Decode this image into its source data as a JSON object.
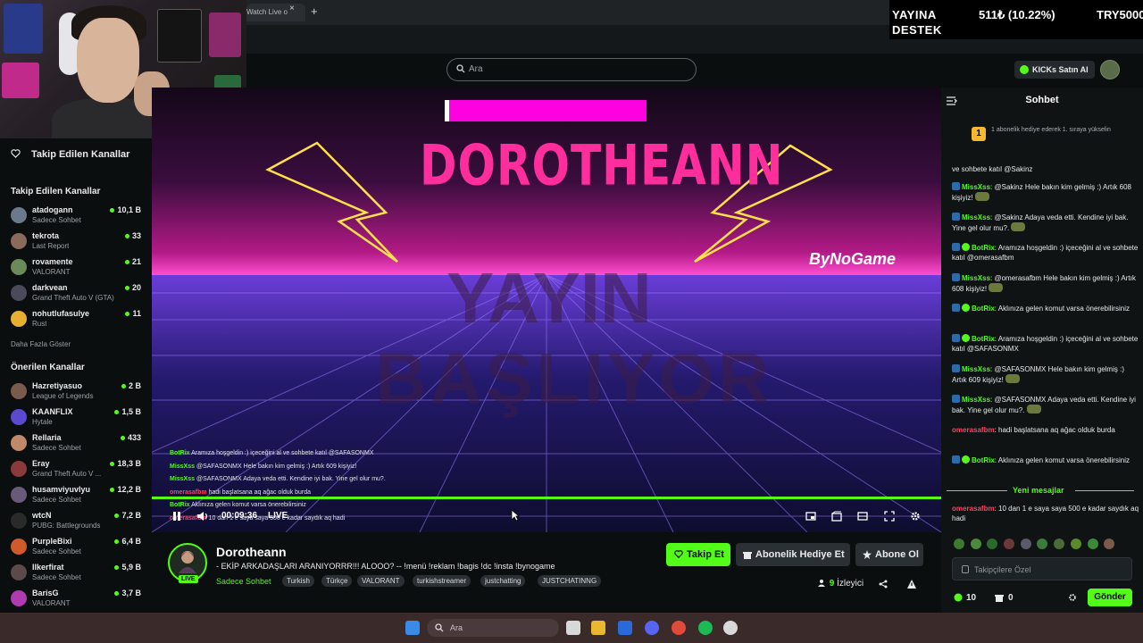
{
  "browser": {
    "tab_label": "Watch Live o",
    "tab_close": "×",
    "new_tab": "+"
  },
  "overlay": {
    "line1": "YAYINA",
    "line2": "DESTEK",
    "amount": "511₺ (10.22%)",
    "goal": "TRY5000"
  },
  "header": {
    "search_placeholder": "Ara",
    "kicks_button": "KICKs Satın Al"
  },
  "sidebar": {
    "title": "Takip Edilen Kanallar",
    "followed_header": "Takip Edilen Kanallar",
    "followed": [
      {
        "name": "atadogann",
        "category": "Sadece Sohbet",
        "viewers": "10,1 B",
        "color": "#6a7a8a"
      },
      {
        "name": "tekrota",
        "category": "Last Report",
        "viewers": "33",
        "color": "#8a6a5a"
      },
      {
        "name": "rovamente",
        "category": "VALORANT",
        "viewers": "21",
        "color": "#6a8a5a"
      },
      {
        "name": "darkvean",
        "category": "Grand Theft Auto V (GTA)",
        "viewers": "20",
        "color": "#4a4a5a"
      },
      {
        "name": "nohutlufasulye",
        "category": "Rust",
        "viewers": "11",
        "color": "#e8b030"
      }
    ],
    "show_more": "Daha Fazla Göster",
    "recommended_header": "Önerilen Kanallar",
    "recommended": [
      {
        "name": "Hazretiyasuo",
        "category": "League of Legends",
        "viewers": "2 B",
        "color": "#7a5a4a"
      },
      {
        "name": "KAANFLIX",
        "category": "Hytale",
        "viewers": "1,5 B",
        "color": "#5a4ad0"
      },
      {
        "name": "Rellaria",
        "category": "Sadece Sohbet",
        "viewers": "433",
        "color": "#c08a6a"
      },
      {
        "name": "Eray",
        "category": "Grand Theft Auto V ...",
        "viewers": "18,3 B",
        "color": "#8a3a3a"
      },
      {
        "name": "husamviyuvlyu",
        "category": "Sadece Sohbet",
        "viewers": "12,2 B",
        "color": "#6a5a7a"
      },
      {
        "name": "wtcN",
        "category": "PUBG: Battlegrounds",
        "viewers": "7,2 B",
        "color": "#2a2a2a"
      },
      {
        "name": "PurpleBixi",
        "category": "Sadece Sohbet",
        "viewers": "6,4 B",
        "color": "#d05a2a"
      },
      {
        "name": "Ilkerfirat",
        "category": "Sadece Sohbet",
        "viewers": "5,9 B",
        "color": "#5a4a4a"
      },
      {
        "name": "BarisG",
        "category": "VALORANT",
        "viewers": "3,7 B",
        "color": "#b03ab0"
      }
    ]
  },
  "video": {
    "title_art": "DOROTHEANN",
    "brand_art": "ByNoGame",
    "starting_line1": "YAYIN",
    "starting_line2": "BAŞLIYOR",
    "overlay_chat": [
      {
        "user": "BotRix",
        "text": "Aramıza hoşgeldin :) içeceğini al ve sohbete katıl @SAFASONMX"
      },
      {
        "user": "MissXss",
        "text": "@SAFASONMX Hele bakın kim gelmiş :) Artık 609 kişiyiz!"
      },
      {
        "user": "MissXss",
        "text": "@SAFASONMX Adaya veda etti. Kendine iyi bak. Yine gel olur mu?."
      },
      {
        "user": "omerasafbm",
        "text": "hadi başlatsana aq ağac olduk burda"
      },
      {
        "user": "BotRix",
        "text": "Aklınıza gelen komut varsa önerebilirsiniz"
      },
      {
        "user": "omerasafbm",
        "text": "10 dan 1 e saya saya 500 e kadar saydık aq hadi"
      }
    ],
    "elapsed": "00:09:36",
    "live_label": "LIVE",
    "progress": 1.0
  },
  "stream": {
    "name": "Dorotheann",
    "live_badge": "LIVE",
    "title": "- EKİP ARKADAŞLARI ARANIYORRR!!! ALOOO? -- !menü !reklam !bagis !dc !insta !bynogame",
    "category": "Sadece Sohbet",
    "tags": [
      "Turkish",
      "Türkçe",
      "VALORANT",
      "turkishstreamer",
      "justchatting",
      "JUSTCHATINNG"
    ],
    "follow_button": "Takip Et",
    "gift_button": "Abonelik Hediye Et",
    "subscribe_button": "Abone Ol",
    "viewer_count": "9",
    "viewer_label": "İzleyici"
  },
  "chat": {
    "title": "Sohbet",
    "pinned_rank": "1",
    "pinned_text": "1 abonelik hediye ederek 1. sıraya yükselin",
    "messages": [
      {
        "user": "",
        "text": "ve sohbete katıl @Sakinz"
      },
      {
        "user": "MissXss",
        "text": "@Sakinz Hele bakın kim gelmiş :) Artık 608 kişiyiz!"
      },
      {
        "user": "MissXss",
        "text": "@Sakinz Adaya veda etti. Kendine iyi bak. Yine gel olur mu?."
      },
      {
        "user": "BotRix",
        "text": "Aramıza hoşgeldin :) içeceğini al ve sohbete katıl @omerasafbm"
      },
      {
        "user": "MissXss",
        "text": "@omerasafbm Hele bakın kim gelmiş :) Artık 608 kişiyiz!"
      },
      {
        "user": "BotRix",
        "text": "Aklınıza gelen komut varsa önerebilirsiniz"
      },
      {
        "user": "BotRix",
        "text": "Aramıza hoşgeldin :) içeceğini al ve sohbete katıl @SAFASONMX"
      },
      {
        "user": "MissXss",
        "text": "@SAFASONMX Hele bakın kim gelmiş :) Artık 609 kişiyiz!"
      },
      {
        "user": "MissXss",
        "text": "@SAFASONMX Adaya veda etti. Kendine iyi bak. Yine gel olur mu?."
      },
      {
        "user": "omerasafbm",
        "text": "hadi başlatsana aq ağac olduk burda"
      },
      {
        "user": "BotRix",
        "text": "Aklınıza gelen komut varsa önerebilirsiniz"
      }
    ],
    "new_messages": "Yeni mesajlar",
    "new_message": {
      "user": "omerasafbm",
      "text": "10 dan 1 e saya saya 500 e kadar saydık aq hadi"
    },
    "input_placeholder": "Takipçilere Özel",
    "kicks_count": "10",
    "gift_count": "0",
    "send_button": "Gönder"
  },
  "taskbar": {
    "search_placeholder": "Ara"
  }
}
